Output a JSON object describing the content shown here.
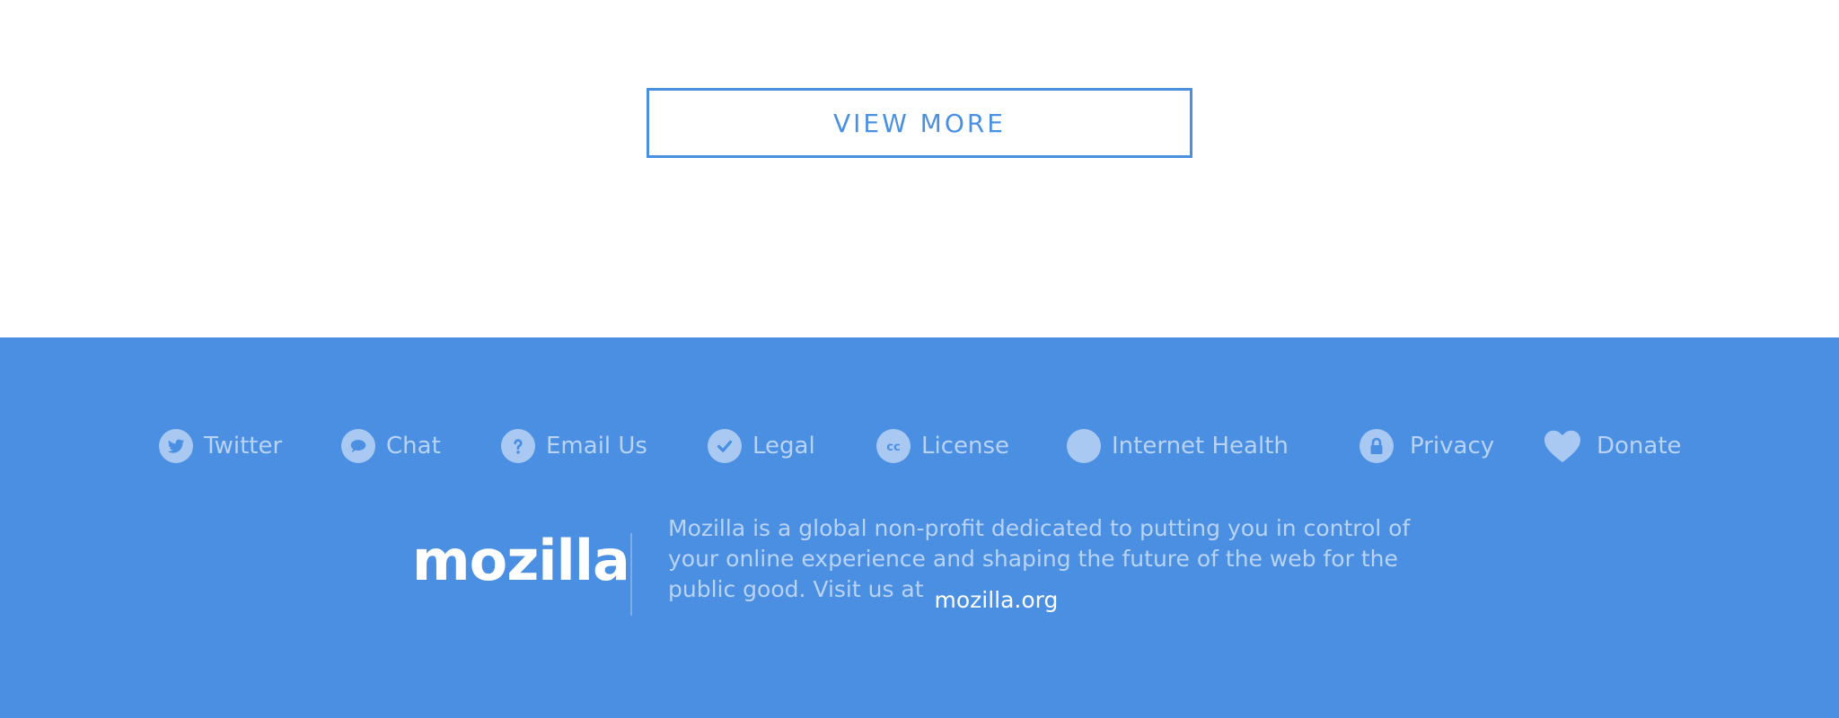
{
  "view_more": {
    "label": "VIEW MORE"
  },
  "footer": {
    "nav": [
      {
        "label": "Twitter",
        "icon": "twitter-icon"
      },
      {
        "label": "Chat",
        "icon": "chat-icon"
      },
      {
        "label": "Email Us",
        "icon": "help-icon"
      },
      {
        "label": "Legal",
        "icon": "check-icon"
      },
      {
        "label": "License",
        "icon": "cc-icon"
      },
      {
        "label": "Internet Health",
        "icon": "globe-icon"
      },
      {
        "label": "Privacy",
        "icon": "lock-icon"
      },
      {
        "label": "Donate",
        "icon": "heart-icon"
      }
    ],
    "logo": "mozilla",
    "about_text": "Mozilla is a global non-profit dedicated to putting you in control of your online experience and shaping the future of the web for the public good. Visit us at",
    "about_link": "mozilla.org"
  },
  "colors": {
    "accent": "#4a90e2",
    "footer_bg": "#4a8fe2",
    "footer_text": "#b9d3f5",
    "icon_fill": "#a9c9f3",
    "white": "#ffffff"
  }
}
